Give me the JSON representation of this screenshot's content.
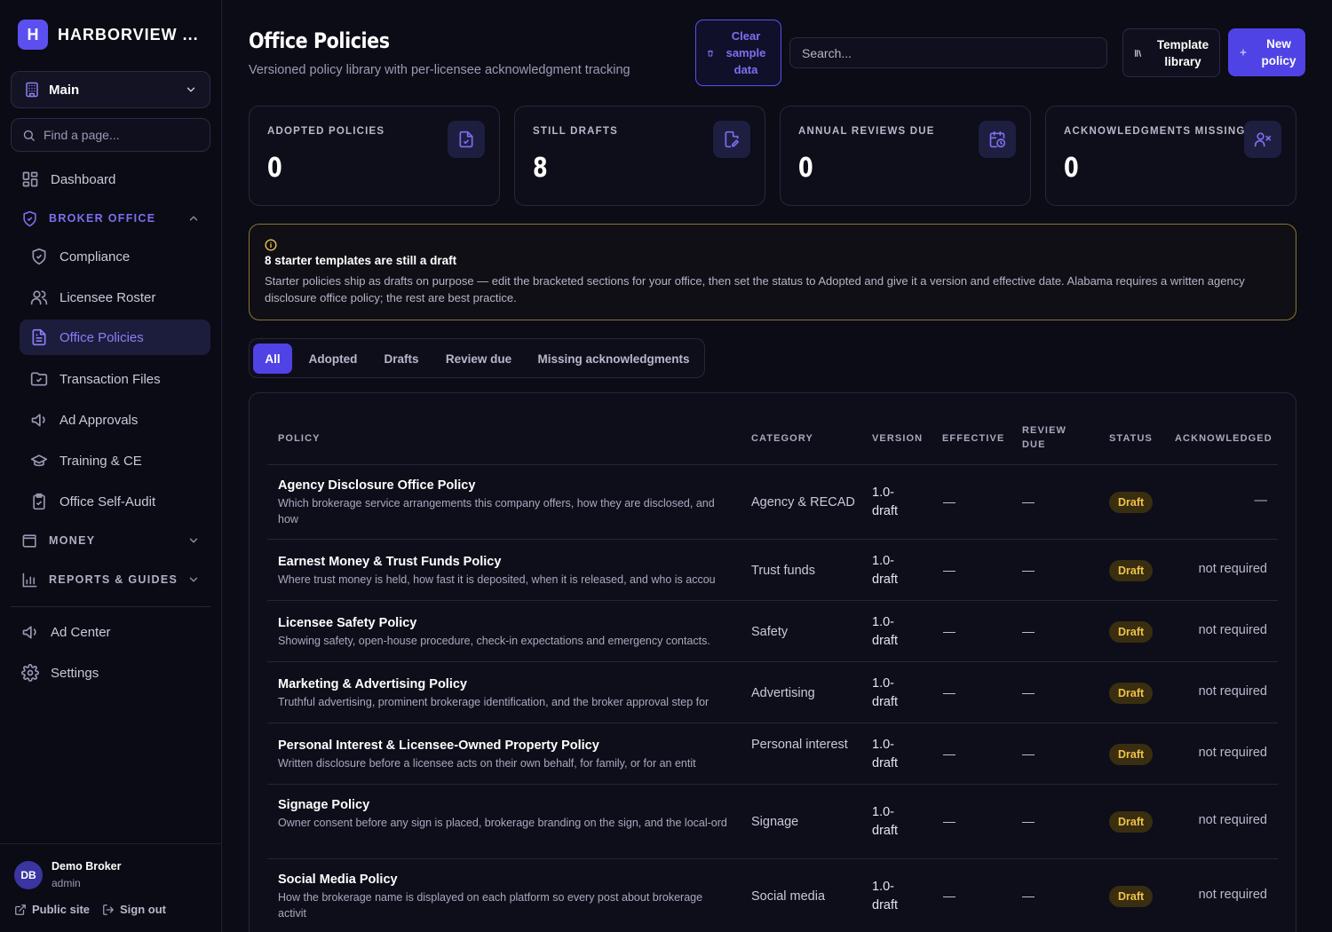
{
  "brand": {
    "initial": "H",
    "name": "HARBORVIEW ..."
  },
  "sidebar": {
    "workspace": "Main",
    "find_placeholder": "Find a page...",
    "dashboard": "Dashboard",
    "section_broker": "BROKER OFFICE",
    "broker_items": [
      "Compliance",
      "Licensee Roster",
      "Office Policies",
      "Transaction Files",
      "Ad Approvals",
      "Training & CE",
      "Office Self-Audit"
    ],
    "section_money": "MONEY",
    "section_reports": "REPORTS & GUIDES",
    "ad_center": "Ad Center",
    "settings": "Settings"
  },
  "user": {
    "initials": "DB",
    "name": "Demo Broker",
    "role": "admin",
    "public_site": "Public site",
    "sign_out": "Sign out"
  },
  "header": {
    "title": "Office Policies",
    "subtitle": "Versioned policy library with per-licensee acknowledgment tracking",
    "clear_button": "Clear sample data",
    "search_placeholder": "Search...",
    "template_button": "Template library",
    "new_button": "New policy"
  },
  "stats": [
    {
      "label": "ADOPTED POLICIES",
      "value": "0",
      "icon": "file-check-icon"
    },
    {
      "label": "STILL DRAFTS",
      "value": "8",
      "icon": "file-edit-icon"
    },
    {
      "label": "ANNUAL REVIEWS DUE",
      "value": "0",
      "icon": "calendar-clock-icon"
    },
    {
      "label": "ACKNOWLEDGMENTS MISSING",
      "value": "0",
      "icon": "user-x-icon"
    }
  ],
  "notice": {
    "title": "8 starter templates are still a draft",
    "body": "Starter policies ship as drafts on purpose — edit the bracketed sections for your office, then set the status to Adopted and give it a version and effective date. Alabama requires a written agency disclosure office policy; the rest are best practice."
  },
  "tabs": [
    "All",
    "Adopted",
    "Drafts",
    "Review due",
    "Missing acknowledgments"
  ],
  "table": {
    "columns": [
      "POLICY",
      "CATEGORY",
      "VERSION",
      "EFFECTIVE",
      "REVIEW DUE",
      "STATUS",
      "ACKNOWLEDGED"
    ],
    "rows": [
      {
        "name": "Agency Disclosure Office Policy",
        "desc": "Which brokerage service arrangements this company offers, how they are disclosed, and how",
        "category": "Agency & RECAD",
        "version": "1.0-draft",
        "effective": "—",
        "review": "—",
        "status": "Draft",
        "ack": "—"
      },
      {
        "name": "Earnest Money & Trust Funds Policy",
        "desc": "Where trust money is held, how fast it is deposited, when it is released, and who is accou",
        "category": "Trust funds",
        "version": "1.0-draft",
        "effective": "—",
        "review": "—",
        "status": "Draft",
        "ack": "not required"
      },
      {
        "name": "Licensee Safety Policy",
        "desc": "Showing safety, open-house procedure, check-in expectations and emergency contacts.",
        "category": "Safety",
        "version": "1.0-draft",
        "effective": "—",
        "review": "—",
        "status": "Draft",
        "ack": "not required"
      },
      {
        "name": "Marketing & Advertising Policy",
        "desc": "Truthful advertising, prominent brokerage identification, and the broker approval step for",
        "category": "Advertising",
        "version": "1.0-draft",
        "effective": "—",
        "review": "—",
        "status": "Draft",
        "ack": "not required"
      },
      {
        "name": "Personal Interest & Licensee-Owned Property Policy",
        "desc": "Written disclosure before a licensee acts on their own behalf, for family, or for an entit",
        "category": "Personal interest",
        "version": "1.0-draft",
        "effective": "—",
        "review": "—",
        "status": "Draft",
        "ack": "not required"
      },
      {
        "name": "Signage Policy",
        "desc": "Owner consent before any sign is placed, brokerage branding on the sign, and the local-ord",
        "category": "Signage",
        "version": "1.0-draft",
        "effective": "—",
        "review": "—",
        "status": "Draft",
        "ack": "not required"
      },
      {
        "name": "Social Media Policy",
        "desc": "How the brokerage name is displayed on each platform so every post about brokerage activit",
        "category": "Social media",
        "version": "1.0-draft",
        "effective": "—",
        "review": "—",
        "status": "Draft",
        "ack": "not required"
      }
    ]
  }
}
